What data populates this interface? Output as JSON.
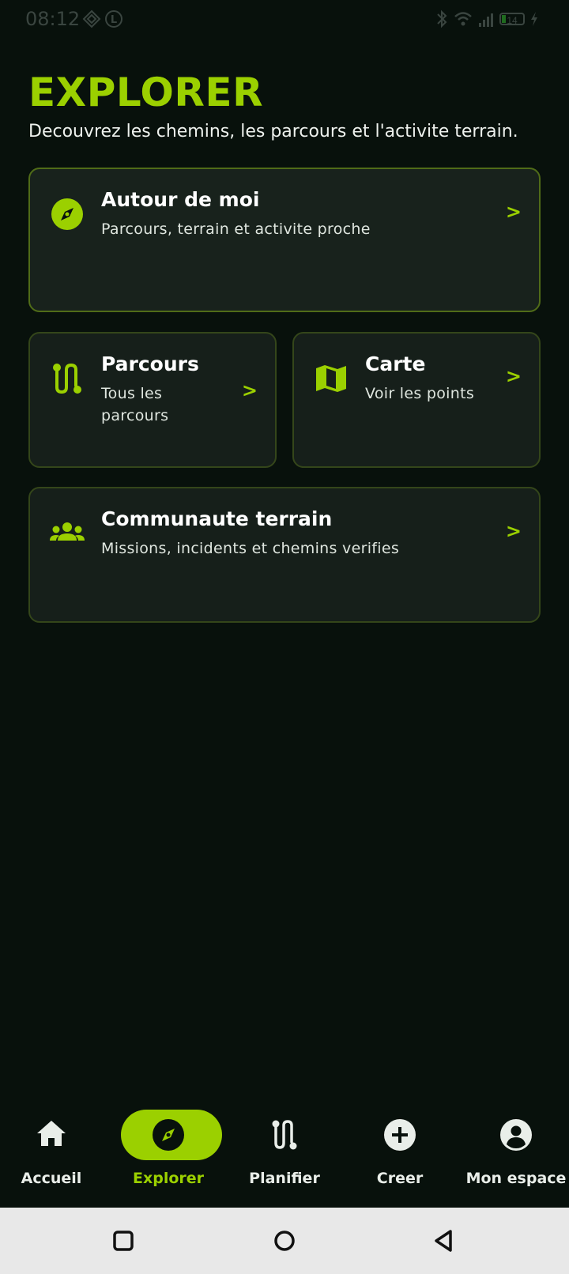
{
  "status_bar": {
    "time": "08:12",
    "battery_level": "14"
  },
  "header": {
    "title": "EXPLORER",
    "subtitle": "Decouvrez les chemins, les parcours et l'activite terrain."
  },
  "cards": {
    "around_me": {
      "title": "Autour de moi",
      "description": "Parcours, terrain et activite proche",
      "chevron": ">",
      "icon": "compass-icon"
    },
    "routes": {
      "title": "Parcours",
      "description": "Tous les parcours",
      "chevron": ">",
      "icon": "route-icon"
    },
    "map": {
      "title": "Carte",
      "description": "Voir les points",
      "chevron": ">",
      "icon": "map-icon"
    },
    "community": {
      "title": "Communaute terrain",
      "description": "Missions, incidents et chemins verifies",
      "chevron": ">",
      "icon": "group-icon"
    }
  },
  "bottom_nav": {
    "items": [
      {
        "label": "Accueil",
        "icon": "home-icon"
      },
      {
        "label": "Explorer",
        "icon": "compass-icon",
        "active": true
      },
      {
        "label": "Planifier",
        "icon": "route-icon"
      },
      {
        "label": "Creer",
        "icon": "add-circle-icon"
      },
      {
        "label": "Mon espace",
        "icon": "account-circle-icon"
      }
    ]
  },
  "colors": {
    "accent": "#9bd000",
    "background": "#08110c",
    "card": "#161f1a",
    "card_border": "#3e5318"
  }
}
